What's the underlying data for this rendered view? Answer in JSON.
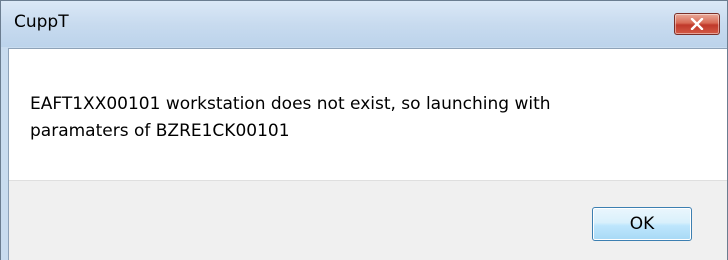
{
  "window": {
    "title": "CuppT",
    "close_icon": "close-icon"
  },
  "dialog": {
    "message_line1": "EAFT1XX00101 workstation does not exist, so launching with",
    "message_line2": "paramaters of BZRE1CK00101",
    "ok_label": "OK"
  },
  "colors": {
    "titlebar": "#c8dbef",
    "close_button": "#c0392b",
    "footer": "#f0f0f0",
    "ok_border": "#3c7fb1"
  }
}
